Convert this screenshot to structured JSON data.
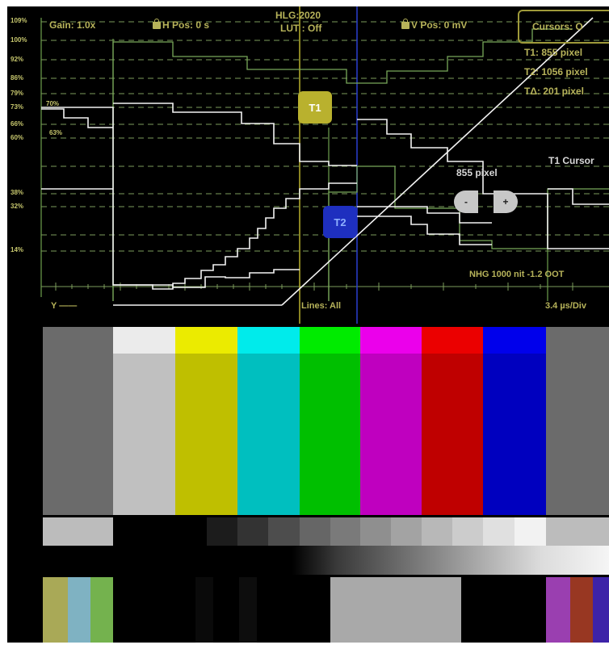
{
  "graticule": {
    "labels": [
      "109%",
      "100%",
      "92%",
      "86%",
      "79%",
      "73%",
      "66%",
      "60%",
      "38%",
      "32%",
      "14%"
    ],
    "trace_labels": [
      "70%",
      "63%"
    ]
  },
  "status": {
    "gain": "Gain: 1.0x",
    "h_pos": "H Pos: 0 s",
    "hlg": "HLG:2020",
    "lut": "LUT : Off",
    "v_pos": "V Pos: 0 mV",
    "cursors_button": "Cursors: O",
    "channel": "Y",
    "lines": "Lines: All",
    "timebase": "3.4 µs/Div",
    "nits": "NHG 1000 nit -1.2 OOT"
  },
  "cursors": {
    "t1_readout": "T1: 855 pixel",
    "t2_readout": "T2: 1056 pixel",
    "delta_readout": "TΔ: 201 pixel",
    "t1_label": "T1",
    "t2_label": "T2",
    "adjust_title": "T1 Cursor",
    "adjust_value": "855 pixel",
    "minus_label": "-",
    "plus_label": "+"
  },
  "colors": {
    "trace": "#f2f2f2",
    "graticule": "#7d9d5c",
    "hud_text": "#b7b35a",
    "t1_cursor": "#b9b12e",
    "t2_cursor": "#1e2fbf"
  },
  "color_bars": {
    "top_row": [
      "#6b6b6b",
      "#c0c0c0",
      "#bfbf00",
      "#00bfbf",
      "#00bf00",
      "#bf00bf",
      "#bf0000",
      "#0000bf",
      "#6b6b6b"
    ],
    "top_strip": [
      "#6b6b6b",
      "#ebebeb",
      "#ebeb00",
      "#00ebeb",
      "#00eb00",
      "#eb00eb",
      "#eb0000",
      "#0000eb",
      "#6b6b6b"
    ]
  }
}
